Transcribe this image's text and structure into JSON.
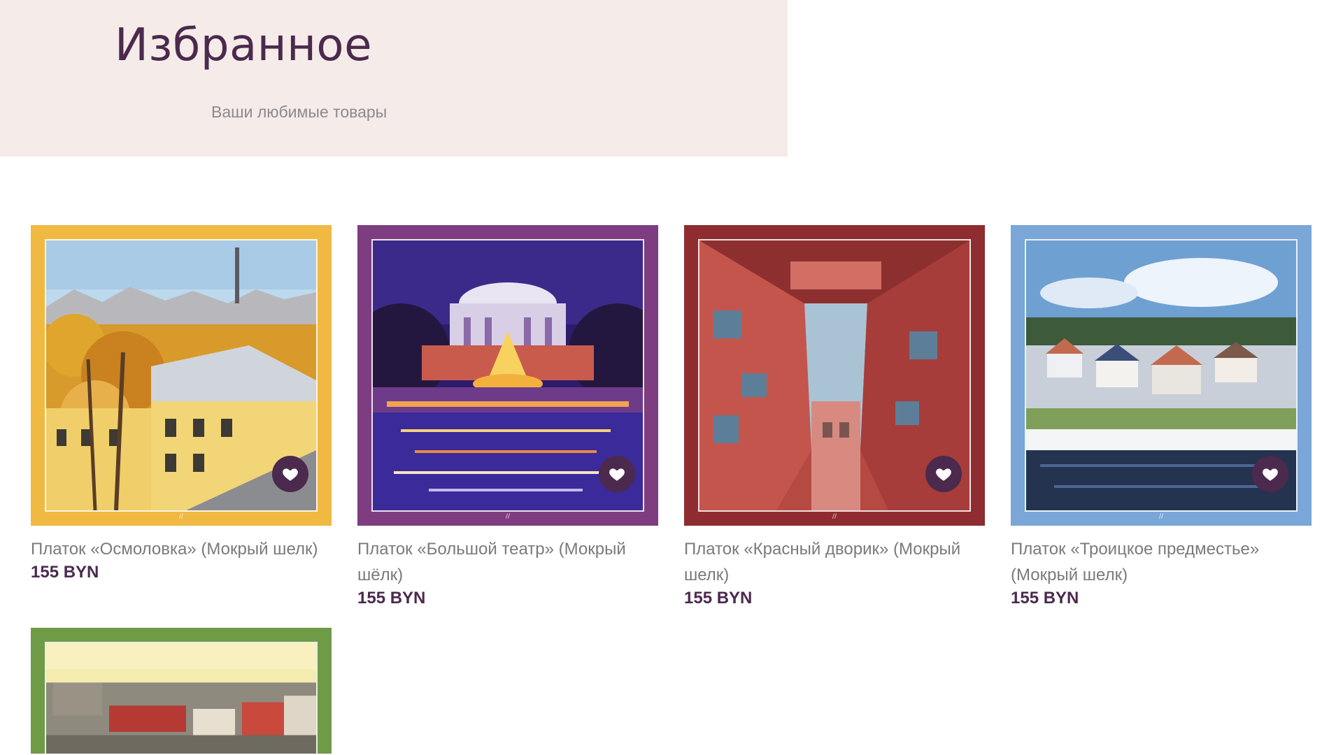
{
  "header": {
    "title": "Избранное",
    "subtitle": "Ваши любимые товары"
  },
  "products": [
    {
      "title": "Платок «Осмоловка» (Мокрый шелк)",
      "price": "155 BYN",
      "frame_color": "#f0b942",
      "favorite_icon": "heart-icon"
    },
    {
      "title": "Платок «Большой театр» (Мокрый шёлк)",
      "price": "155 BYN",
      "frame_color": "#7e3d80",
      "favorite_icon": "heart-icon"
    },
    {
      "title": "Платок «Красный дворик» (Мокрый шелк)",
      "price": "155 BYN",
      "frame_color": "#8e2c2f",
      "favorite_icon": "heart-icon"
    },
    {
      "title": "Платок «Троицкое предместье» (Мокрый шелк)",
      "price": "155 BYN",
      "frame_color": "#7aa6d8",
      "favorite_icon": "heart-icon"
    },
    {
      "frame_color": "#6f9a46"
    }
  ],
  "colors": {
    "brand": "#4b2a4d",
    "hero_background": "#f5ebe9",
    "muted_text": "#7b7a7b"
  }
}
